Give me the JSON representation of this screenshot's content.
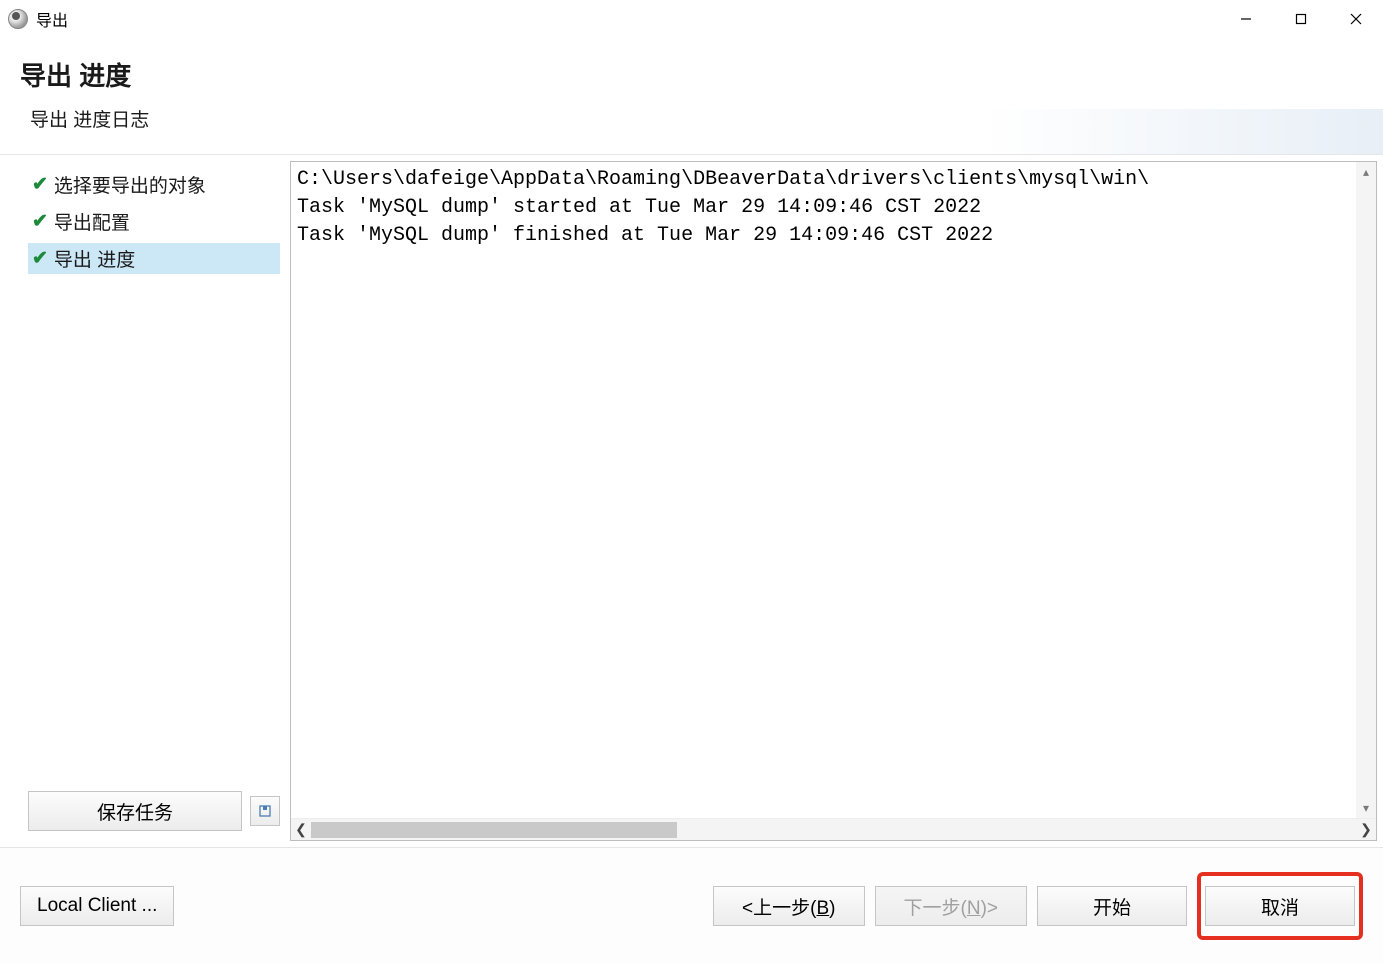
{
  "window": {
    "title": "导出"
  },
  "header": {
    "title": "导出 进度",
    "subtitle": "导出 进度日志"
  },
  "sidebar": {
    "steps": [
      {
        "label": "选择要导出的对象",
        "done": true,
        "selected": false
      },
      {
        "label": "导出配置",
        "done": true,
        "selected": false
      },
      {
        "label": "导出 进度",
        "done": true,
        "selected": true
      }
    ],
    "save_task_label": "保存任务"
  },
  "log": {
    "lines": [
      "C:\\Users\\dafeige\\AppData\\Roaming\\DBeaverData\\drivers\\clients\\mysql\\win\\",
      "Task 'MySQL dump' started at Tue Mar 29 14:09:46 CST 2022",
      "Task 'MySQL dump' finished at Tue Mar 29 14:09:46 CST 2022"
    ]
  },
  "footer": {
    "local_client_label": "Local Client ...",
    "back_prefix": "<上一步(",
    "back_hotkey": "B",
    "back_suffix": ")",
    "next_prefix": "下一步(",
    "next_hotkey": "N",
    "next_suffix": ")>",
    "start_label": "开始",
    "cancel_label": "取消"
  }
}
